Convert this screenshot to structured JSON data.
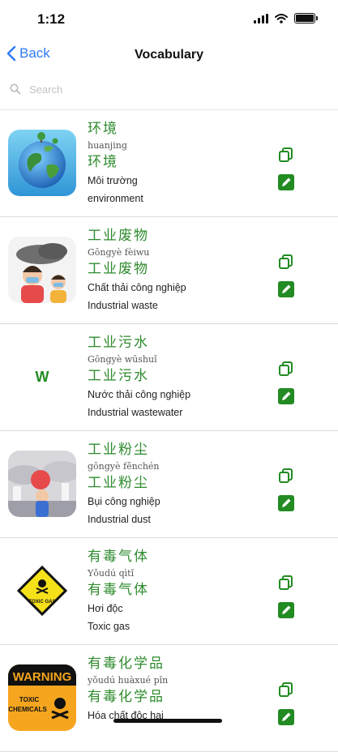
{
  "status": {
    "time": "1:12"
  },
  "nav": {
    "back_label": "Back",
    "title": "Vocabulary"
  },
  "search": {
    "placeholder": "Search"
  },
  "colors": {
    "accent": "#2f7bf5",
    "green": "#228b22",
    "hanzi": "#2e8b2e"
  },
  "items": [
    {
      "hanzi": "环境",
      "pinyin": "huanjing",
      "hanzi2": "环境",
      "vietnamese": "Môi trường",
      "english": "environment",
      "image": "earth-globe"
    },
    {
      "hanzi": "工业废物",
      "pinyin": "Gōngyè fèiwu",
      "hanzi2": "工业废物",
      "vietnamese": "Chất thải công nghiệp",
      "english": "Industrial waste",
      "image": "smog-kids"
    },
    {
      "hanzi": "工业污水",
      "pinyin": "Gōngyè wūshuǐ",
      "hanzi2": "工业污水",
      "vietnamese": "Nước thải công nghiệp",
      "english": "Industrial wastewater",
      "image": "letter",
      "letter": "W"
    },
    {
      "hanzi": "工业粉尘",
      "pinyin": "gōngyè fěnchén",
      "hanzi2": "工业粉尘",
      "vietnamese": "Bụi công nghiệp",
      "english": "Industrial dust",
      "image": "factory-dust"
    },
    {
      "hanzi": "有毒气体",
      "pinyin": "Yǒudú qìtǐ",
      "hanzi2": "有毒气体",
      "vietnamese": "Hơi độc",
      "english": "Toxic gas",
      "image": "toxic-gas-sign",
      "sign_text": "TOXIC GAS"
    },
    {
      "hanzi": "有毒化学品",
      "pinyin": "yǒudú huàxué pǐn",
      "hanzi2": "有毒化学品",
      "vietnamese": "Hóa chất độc hại",
      "english": "",
      "image": "warning-toxic-chemicals",
      "sign_text": [
        "WARNING",
        "TOXIC",
        "CHEMICALS"
      ]
    }
  ]
}
